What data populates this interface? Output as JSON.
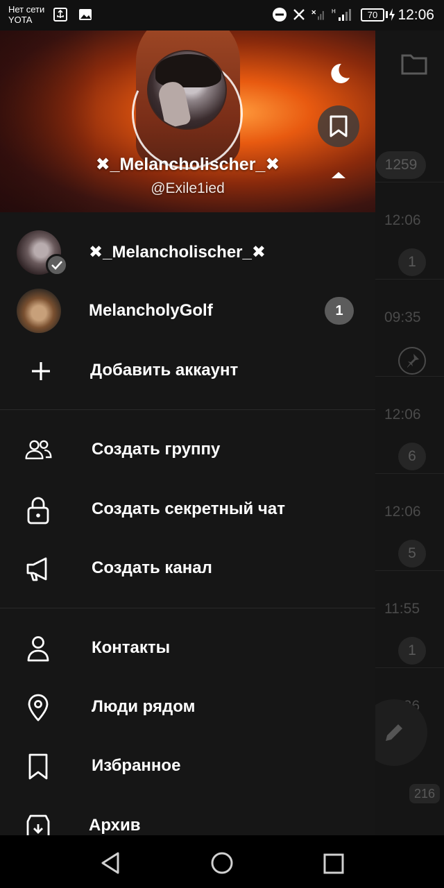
{
  "status_bar": {
    "carrier_line1": "Нет сети",
    "carrier_line2": "YOTA",
    "battery": "70",
    "time": "12:06"
  },
  "background_list": {
    "badge_1259": "1259",
    "times": [
      "12:06",
      "09:35",
      "12:06",
      "12:06",
      "11:55",
      "11:36"
    ],
    "badges": [
      "1",
      "6",
      "5",
      "1"
    ],
    "archive_count": "216"
  },
  "drawer": {
    "profile_name": "✖_Melancholischer_✖",
    "profile_handle": "@Exile1ied",
    "accounts": [
      {
        "name": "✖_Melancholischer_✖"
      },
      {
        "name": "MelancholyGolf",
        "unread": "1"
      }
    ],
    "add_account": "Добавить аккаунт",
    "menu": {
      "new_group": "Создать группу",
      "new_secret_chat": "Создать секретный чат",
      "new_channel": "Создать канал",
      "contacts": "Контакты",
      "people_nearby": "Люди рядом",
      "saved_messages": "Избранное",
      "archive": "Архив"
    }
  },
  "icons": [
    "usb-icon",
    "image-icon",
    "dnd-icon",
    "mute-icon",
    "signal-icon",
    "moon-icon",
    "bookmark-icon",
    "folder-icon",
    "pin-icon",
    "pencil-icon",
    "plus-icon",
    "group-icon",
    "lock-icon",
    "megaphone-icon",
    "person-icon",
    "location-icon",
    "archive-icon",
    "back-icon",
    "home-icon",
    "recents-icon"
  ]
}
